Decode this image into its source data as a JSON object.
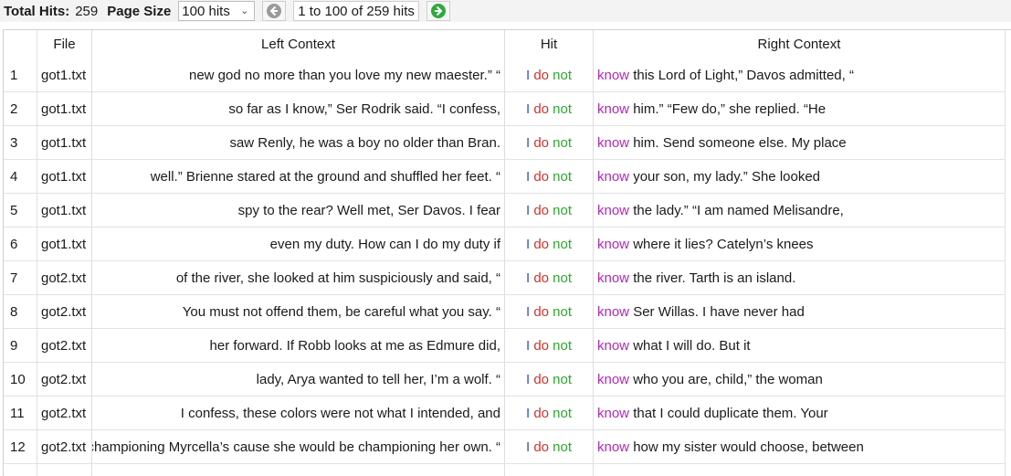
{
  "toolbar": {
    "total_hits_label": "Total Hits:",
    "total_hits_value": "259",
    "page_size_label": "Page Size",
    "page_size_value": "100 hits",
    "range_text": "1 to 100 of 259 hits",
    "prev_icon": "arrow-left-circle-icon",
    "next_icon": "arrow-right-circle-icon",
    "next_color": "#2eaa3c"
  },
  "table": {
    "columns": [
      "",
      "File",
      "Left Context",
      "Hit",
      "Right Context"
    ],
    "hit_colors": [
      "#2f55d4",
      "#d0312d",
      "#2ea82e",
      "#b02ab8"
    ],
    "rows": [
      {
        "idx": "1",
        "file": "got1.txt",
        "left": "new god no more than you love my new maester.” “",
        "hit": [
          "I",
          "do",
          "not"
        ],
        "kw": "know",
        "right": " this Lord of Light,” Davos admitted, “"
      },
      {
        "idx": "2",
        "file": "got1.txt",
        "left": "so far as I know,” Ser Rodrik said. “I confess,",
        "hit": [
          "I",
          "do",
          "not"
        ],
        "kw": "know",
        "right": " him.” “Few do,” she replied. “He"
      },
      {
        "idx": "3",
        "file": "got1.txt",
        "left": "saw Renly, he was a boy no older than Bran.",
        "hit": [
          "I",
          "do",
          "not"
        ],
        "kw": "know",
        "right": " him. Send someone else. My place"
      },
      {
        "idx": "4",
        "file": "got1.txt",
        "left": "well.” Brienne stared at the ground and shuffled her feet. “",
        "hit": [
          "I",
          "do",
          "not"
        ],
        "kw": "know",
        "right": " your son, my lady.” She looked"
      },
      {
        "idx": "5",
        "file": "got1.txt",
        "left": "spy to the rear? Well met, Ser Davos. I fear",
        "hit": [
          "I",
          "do",
          "not"
        ],
        "kw": "know",
        "right": " the lady.” “I am named Melisandre,"
      },
      {
        "idx": "6",
        "file": "got1.txt",
        "left": "even my duty. How can I do my duty if",
        "hit": [
          "I",
          "do",
          "not"
        ],
        "kw": "know",
        "right": " where it lies? Catelyn’s knees"
      },
      {
        "idx": "7",
        "file": "got2.txt",
        "left": "of the river, she looked at him suspiciously and said, “",
        "hit": [
          "I",
          "do",
          "not"
        ],
        "kw": "know",
        "right": " the river. Tarth is an island."
      },
      {
        "idx": "8",
        "file": "got2.txt",
        "left": "You must not offend them, be careful what you say. “",
        "hit": [
          "I",
          "do",
          "not"
        ],
        "kw": "know",
        "right": " Ser Willas. I have never had"
      },
      {
        "idx": "9",
        "file": "got2.txt",
        "left": "her forward. If Robb looks at me as Edmure did,",
        "hit": [
          "I",
          "do",
          "not"
        ],
        "kw": "know",
        "right": " what I will do. But it"
      },
      {
        "idx": "10",
        "file": "got2.txt",
        "left": "lady, Arya wanted to tell her, I’m a wolf. “",
        "hit": [
          "I",
          "do",
          "not"
        ],
        "kw": "know",
        "right": " who you are, child,” the woman"
      },
      {
        "idx": "11",
        "file": "got2.txt",
        "left": "I confess, these colors were not what I intended, and",
        "hit": [
          "I",
          "do",
          "not"
        ],
        "kw": "know",
        "right": " that I could duplicate them. Your"
      },
      {
        "idx": "12",
        "file": "got2.txt",
        "left": "championing Myrcella’s cause she would be championing her own. “",
        "hit": [
          "I",
          "do",
          "not"
        ],
        "kw": "know",
        "right": " how my sister would choose, between"
      }
    ]
  }
}
